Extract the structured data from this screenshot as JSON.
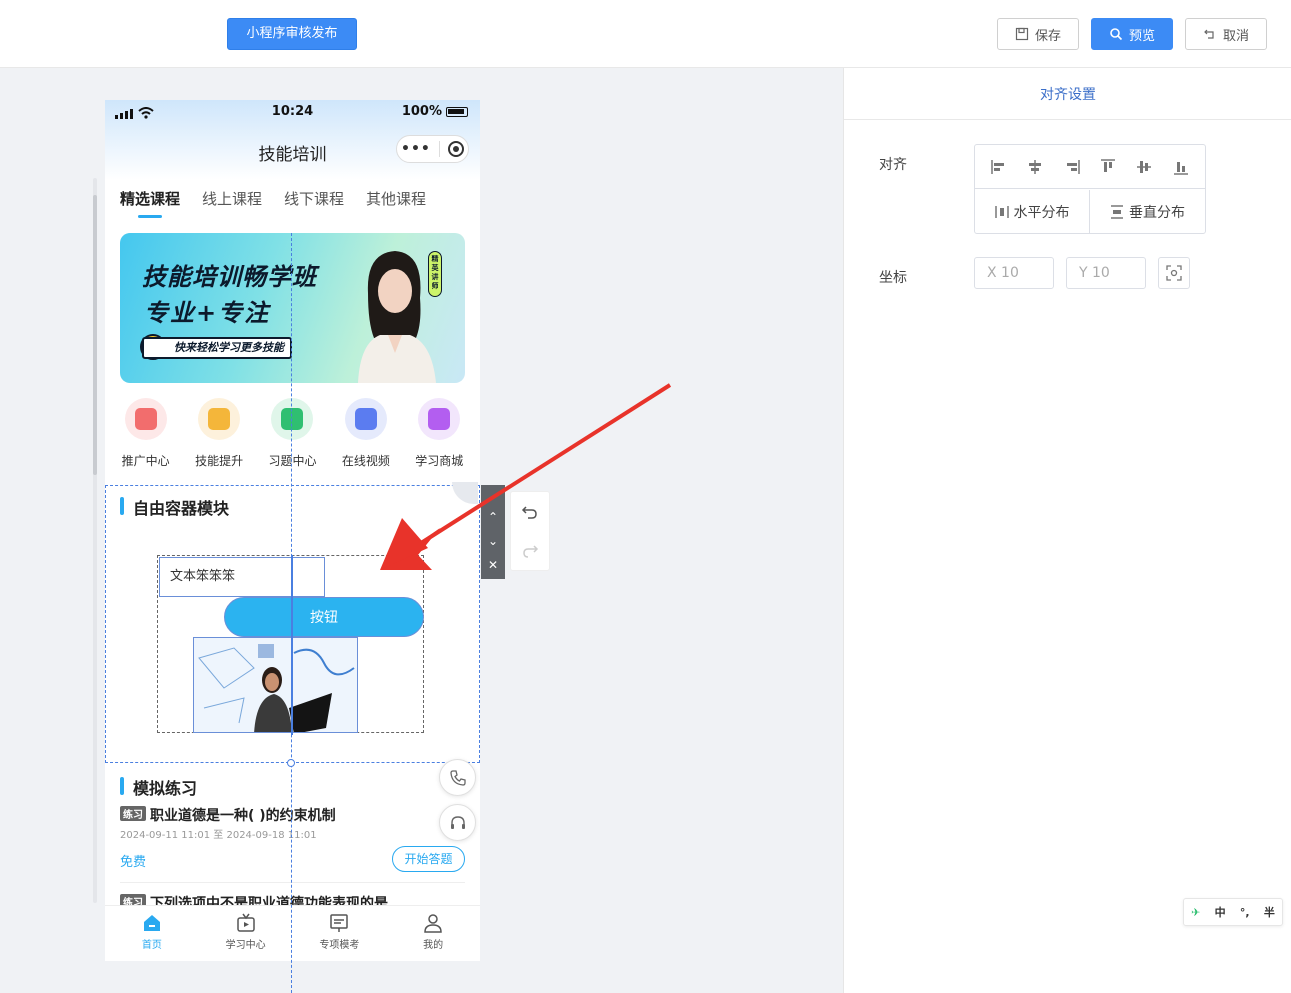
{
  "toolbar": {
    "publish_label": "小程序审核发布",
    "save_label": "保存",
    "preview_label": "预览",
    "cancel_label": "取消"
  },
  "phone": {
    "status": {
      "time": "10:24",
      "battery": "100%"
    },
    "nav_title": "技能培训",
    "tabs": [
      "精选课程",
      "线上课程",
      "线下课程",
      "其他课程"
    ],
    "banner": {
      "line1": "技能培训畅学班",
      "line2": "专业+专注",
      "line3": "快来轻松学习更多技能",
      "badge": "精英讲师"
    },
    "icons": [
      {
        "label": "推广中心",
        "icon": "gift-icon",
        "color": "#f26d6d",
        "bg": "#fde8e8"
      },
      {
        "label": "技能提升",
        "icon": "clipboard-icon",
        "color": "#f4b63a",
        "bg": "#fdf1dc"
      },
      {
        "label": "习题中心",
        "icon": "book-icon",
        "color": "#2fbf71",
        "bg": "#e0f6ea"
      },
      {
        "label": "在线视频",
        "icon": "video-icon",
        "color": "#5b7cf0",
        "bg": "#e5eafc"
      },
      {
        "label": "学习商城",
        "icon": "bag-icon",
        "color": "#b35ef0",
        "bg": "#f2e6fc"
      }
    ],
    "free_container": {
      "title": "自由容器模块",
      "text_value": "文本笨笨笨",
      "button_label": "按钮"
    },
    "practice": {
      "title": "模拟练习",
      "tag": "练习",
      "item1_title": "职业道德是一种( )的约束机制",
      "item1_date": "2024-09-11 11:01 至 2024-09-18 11:01",
      "item1_price": "免费",
      "item1_button": "开始答题",
      "item2_title": "下列选项中不是职业道德功能表现的是"
    },
    "tabbar": [
      "首页",
      "学习中心",
      "专项模考",
      "我的"
    ]
  },
  "panel": {
    "title": "对齐设置",
    "align_label": "对齐",
    "h_distribute": "水平分布",
    "v_distribute": "垂直分布",
    "coord_label": "坐标",
    "x_placeholder": "X  10",
    "y_placeholder": "Y  10"
  },
  "ime": {
    "lang": "中",
    "punct": "°,",
    "width": "半"
  },
  "colors": {
    "accent": "#3c8bf5",
    "brand_cyan": "#29a9f0",
    "arrow": "#e8332a"
  }
}
